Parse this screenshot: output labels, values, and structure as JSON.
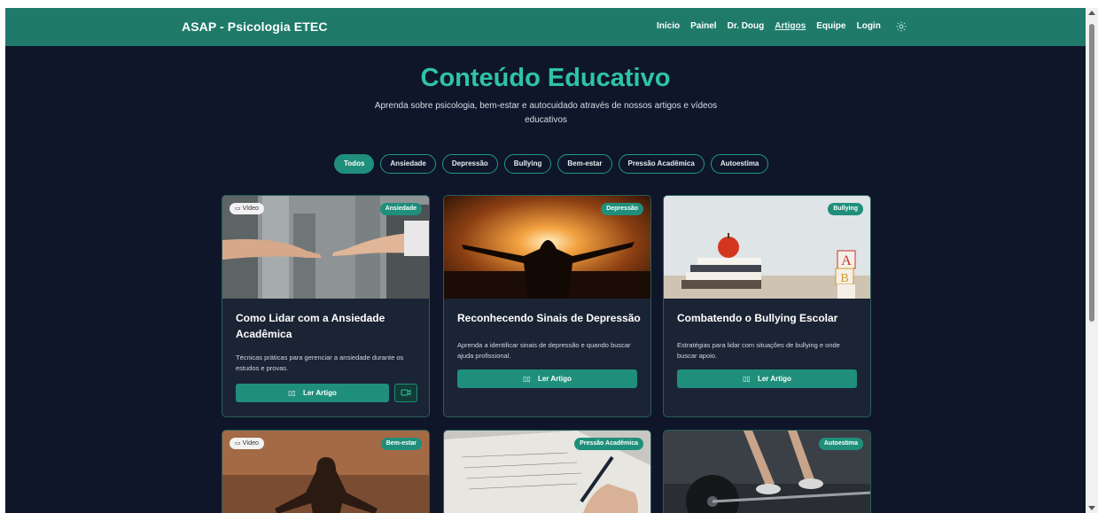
{
  "nav": {
    "brand": "ASAP - Psicologia ETEC",
    "links": [
      "Início",
      "Painel",
      "Dr. Doug",
      "Artigos",
      "Equipe",
      "Login"
    ],
    "active": "Artigos"
  },
  "hero": {
    "title": "Conteúdo Educativo",
    "subtitle": "Aprenda sobre psicologia, bem-estar e autocuidado através de nossos artigos e vídeos educativos"
  },
  "filters": [
    "Todos",
    "Ansiedade",
    "Depressão",
    "Bullying",
    "Bem-estar",
    "Pressão Acadêmica",
    "Autoestima"
  ],
  "filter_selected": "Todos",
  "video_tag": "Vídeo",
  "read_label": "Ler Artigo",
  "cards": [
    {
      "category": "Ansiedade",
      "title": "Como Lidar com a Ansiedade Acadêmica",
      "description": "Técnicas práticas para gerenciar a ansiedade durante os estudos e provas.",
      "has_video": true
    },
    {
      "category": "Depressão",
      "title": "Reconhecendo Sinais de Depressão",
      "description": "Aprenda a identificar sinais de depressão e quando buscar ajuda profissional.",
      "has_video": false
    },
    {
      "category": "Bullying",
      "title": "Combatendo o Bullying Escolar",
      "description": "Estratégias para lidar com situações de bullying e onde buscar apoio.",
      "has_video": false
    },
    {
      "category": "Bem-estar",
      "has_video": true
    },
    {
      "category": "Pressão Acadêmica",
      "has_video": false
    },
    {
      "category": "Autoestima",
      "has_video": false
    }
  ],
  "colors": {
    "accent": "#1f8f7c",
    "nav": "#1f7a6a",
    "title": "#2ec4a6",
    "background": "#0f1629",
    "card": "#1b2434"
  }
}
